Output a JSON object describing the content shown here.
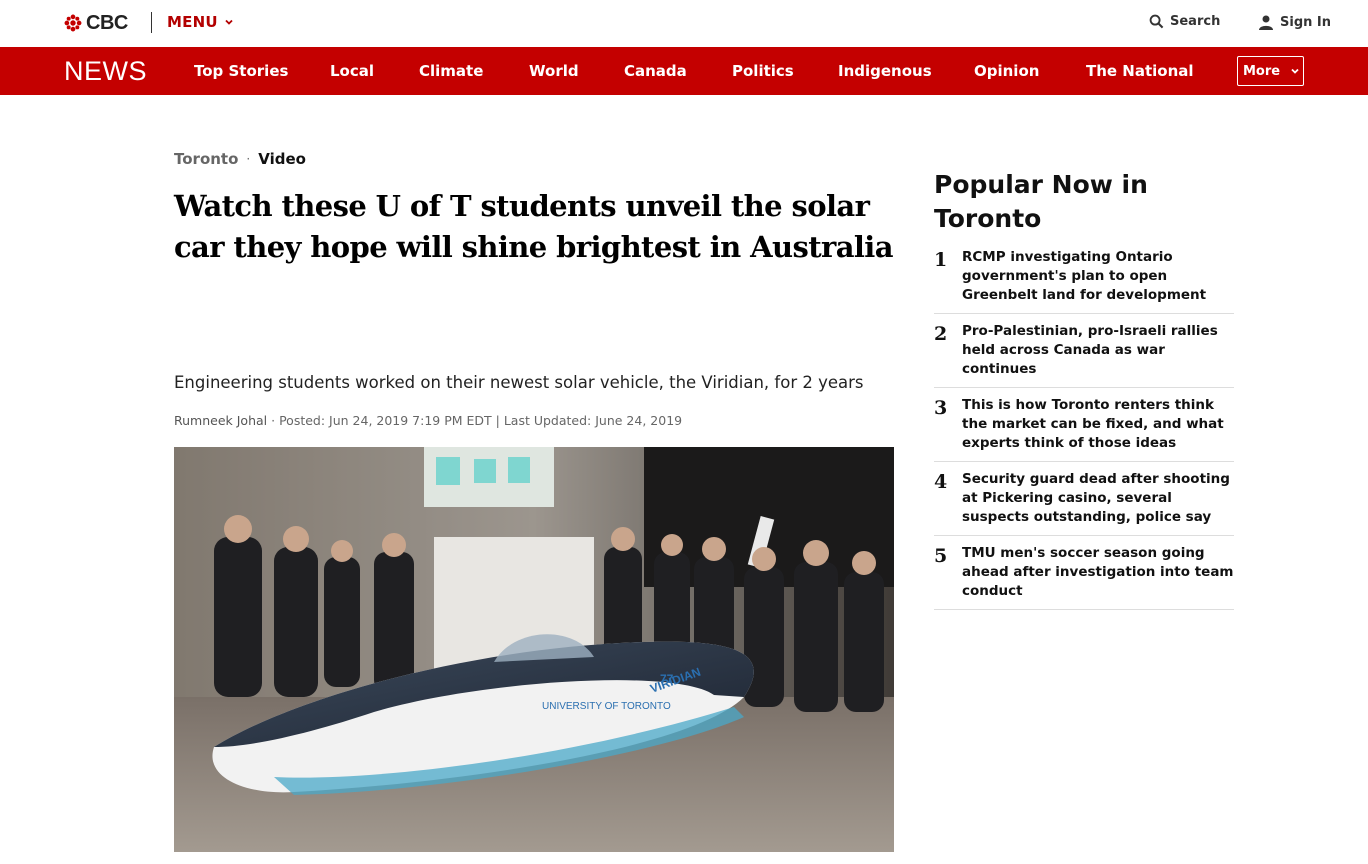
{
  "header": {
    "brand": "CBC",
    "menu_label": "MENU",
    "search_label": "Search",
    "signin_label": "Sign In"
  },
  "nav": {
    "logo": "NEWS",
    "items": [
      "Top Stories",
      "Local",
      "Climate",
      "World",
      "Canada",
      "Politics",
      "Indigenous",
      "Opinion",
      "The National"
    ],
    "more_label": "More"
  },
  "article": {
    "section": "Toronto",
    "type": "Video",
    "headline": "Watch these U of T students unveil the solar car they hope will shine brightest in Australia",
    "deck": "Engineering students worked on their newest solar vehicle, the Viridian, for 2 years",
    "author": "Rumneek Johal",
    "posted": "Posted: Jun 24, 2019 7:19 PM EDT | Last Updated: June 24, 2019",
    "car_name": "VIRIDIAN",
    "university_label": "UNIVERSITY OF TORONTO",
    "car_number": "77"
  },
  "sidebar": {
    "title": "Popular Now in Toronto",
    "items": [
      {
        "num": "1",
        "text": "RCMP investigating Ontario government's plan to open Greenbelt land for development"
      },
      {
        "num": "2",
        "text": "Pro-Palestinian, pro-Israeli rallies held across Canada as war continues"
      },
      {
        "num": "3",
        "text": "This is how Toronto renters think the market can be fixed, and what experts think of those ideas"
      },
      {
        "num": "4",
        "text": "Security guard dead after shooting at Pickering casino, several suspects outstanding, police say"
      },
      {
        "num": "5",
        "text": "TMU men's soccer season going ahead after investigation into team conduct"
      }
    ]
  },
  "colors": {
    "brand_red": "#c40000",
    "menu_red": "#b30000"
  }
}
